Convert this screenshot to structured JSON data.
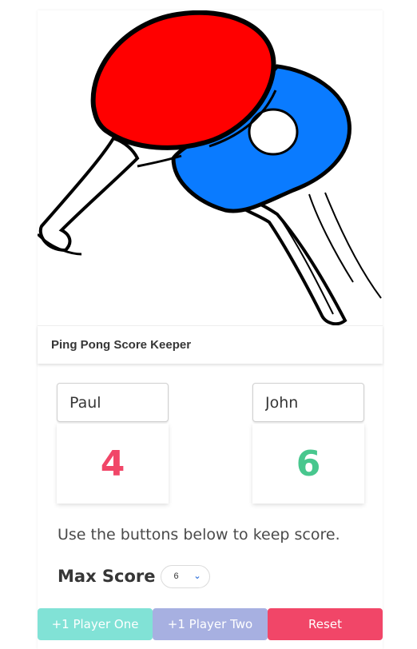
{
  "app": {
    "title": "Ping Pong Score Keeper"
  },
  "players": [
    {
      "name": "Paul",
      "score": "4",
      "color": "#f14668"
    },
    {
      "name": "John",
      "score": "6",
      "color": "#48c78e"
    }
  ],
  "instructions": "Use the buttons below to keep score.",
  "max_score": {
    "label": "Max Score",
    "selected": "6"
  },
  "buttons": {
    "player_one": "+1 Player One",
    "player_two": "+1 Player Two",
    "reset": "Reset"
  },
  "colors": {
    "paddle_red": "#ff0000",
    "paddle_blue": "#0a7bff",
    "player_one_button": "#81e2d6",
    "player_two_button": "#a7b0e1",
    "reset_button": "#f14668"
  },
  "icons": {
    "hero": "ping-pong-paddles-illustration",
    "select": "chevron-down-icon"
  }
}
